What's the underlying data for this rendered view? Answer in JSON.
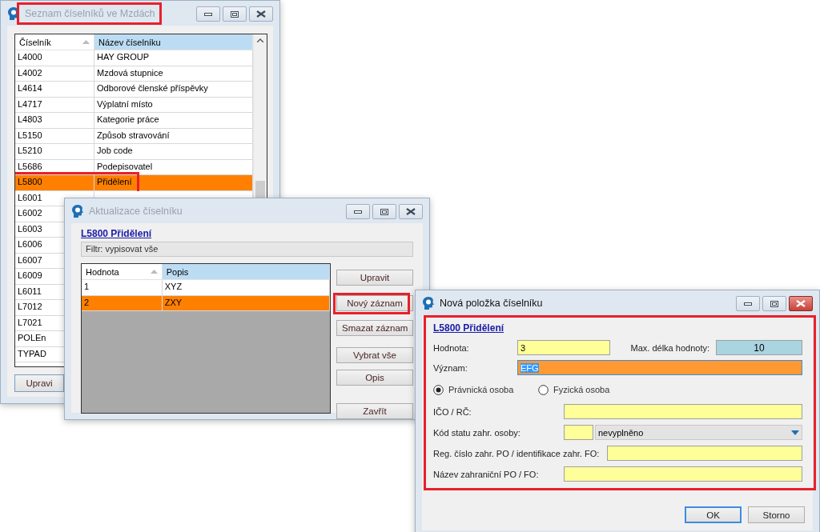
{
  "windows": [
    {
      "kind": "list",
      "title": "Seznam číselníků ve Mzdách",
      "active": false,
      "title_highlighted": true,
      "table": {
        "columns": [
          {
            "label": "Číselník",
            "sorted": true,
            "hovered": false
          },
          {
            "label": "Název číselníku",
            "sorted": false,
            "hovered": true
          }
        ],
        "rows": [
          {
            "code": "L4000",
            "name": "HAY GROUP",
            "selected": false,
            "highlighted": false
          },
          {
            "code": "L4002",
            "name": "Mzdová stupnice",
            "selected": false,
            "highlighted": false
          },
          {
            "code": "L4614",
            "name": "Odborové členské příspěvky",
            "selected": false,
            "highlighted": false
          },
          {
            "code": "L4717",
            "name": "Výplatní místo",
            "selected": false,
            "highlighted": false
          },
          {
            "code": "L4803",
            "name": "Kategorie práce",
            "selected": false,
            "highlighted": false
          },
          {
            "code": "L5150",
            "name": "Způsob stravování",
            "selected": false,
            "highlighted": false
          },
          {
            "code": "L5210",
            "name": "Job code",
            "selected": false,
            "highlighted": false
          },
          {
            "code": "L5686",
            "name": "Podepisovatel",
            "selected": false,
            "highlighted": false
          },
          {
            "code": "L5800",
            "name": "Přidělení",
            "selected": true,
            "highlighted": true
          },
          {
            "code": "L6001",
            "selected": false,
            "highlighted": false
          },
          {
            "code": "L6002",
            "selected": false,
            "highlighted": false
          },
          {
            "code": "L6003",
            "selected": false,
            "highlighted": false
          },
          {
            "code": "L6006",
            "selected": false,
            "highlighted": false
          },
          {
            "code": "L6007",
            "selected": false,
            "highlighted": false
          },
          {
            "code": "L6009",
            "selected": false,
            "highlighted": false
          },
          {
            "code": "L6011",
            "selected": false,
            "highlighted": false
          },
          {
            "code": "L7012",
            "selected": false,
            "highlighted": false
          },
          {
            "code": "L7021",
            "selected": false,
            "highlighted": false
          },
          {
            "code": "POLEn",
            "selected": false,
            "highlighted": false
          },
          {
            "code": "TYPAD",
            "selected": false,
            "highlighted": false
          }
        ]
      },
      "buttons": [
        {
          "label": "Upravi"
        }
      ]
    },
    {
      "kind": "editor",
      "title": "Aktualizace číselníku",
      "active": false,
      "heading": "L5800 Přidělení",
      "filter": "Filtr: vypisovat vše",
      "table": {
        "columns": [
          {
            "label": "Hodnota",
            "sorted": true,
            "hovered": false
          },
          {
            "label": "Popis",
            "sorted": false,
            "hovered": true
          }
        ],
        "rows": [
          {
            "code": "1",
            "name": "XYZ",
            "selected": false,
            "highlighted": false
          },
          {
            "code": "2",
            "name": "ZXY",
            "selected": true,
            "highlighted": false
          }
        ]
      },
      "buttons": [
        {
          "label": "Upravit",
          "highlighted": false
        },
        {
          "label": "Nový záznam",
          "highlighted": true
        },
        {
          "label": "Smazat záznam",
          "highlighted": false
        },
        {
          "label": "Vybrat vše",
          "highlighted": false
        },
        {
          "label": "Opis",
          "highlighted": false
        },
        {
          "label": "Zavřít",
          "highlighted": false
        }
      ]
    },
    {
      "kind": "form",
      "title": "Nová položka číselníku",
      "active": true,
      "form_highlighted": true,
      "heading": "L5800 Přidělení",
      "value_field": {
        "label": "Hodnota:",
        "value": "3"
      },
      "max_length": {
        "label": "Max. délka hodnoty:",
        "value": "10"
      },
      "meaning": {
        "label": "Význam:",
        "value": "EFG",
        "text_selected": true
      },
      "radios": [
        {
          "label": "Právnická osoba",
          "selected": true
        },
        {
          "label": "Fyzická osoba",
          "selected": false
        }
      ],
      "fields": [
        {
          "kind": "text",
          "label": "IČO / RČ:"
        },
        {
          "kind": "combo",
          "label": "Kód statu zahr. osoby:",
          "value": "nevyplněno"
        },
        {
          "kind": "text",
          "label": "Reg. číslo zahr. PO / identifikace zahr. FO:"
        },
        {
          "kind": "text",
          "label": "Název zahraniční PO / FO:"
        }
      ],
      "buttons": [
        {
          "label": "OK",
          "default": true
        },
        {
          "label": "Storno",
          "default": false
        }
      ]
    }
  ]
}
